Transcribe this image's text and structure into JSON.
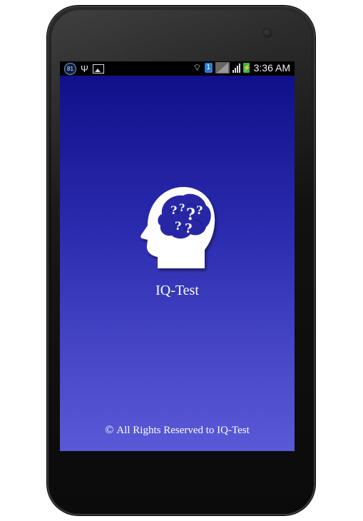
{
  "status_bar": {
    "notification_count": "81",
    "sim_slot": "1",
    "time": "3:36 AM"
  },
  "app": {
    "title": "IQ-Test",
    "logo_icon": "head-with-question-marks-icon",
    "copyright_symbol": "©",
    "footer_text": "All Rights Reserved to IQ-Test",
    "colors": {
      "gradient_top": "#10108a",
      "gradient_bottom": "#5a5ad8",
      "text": "#ffffff"
    }
  }
}
